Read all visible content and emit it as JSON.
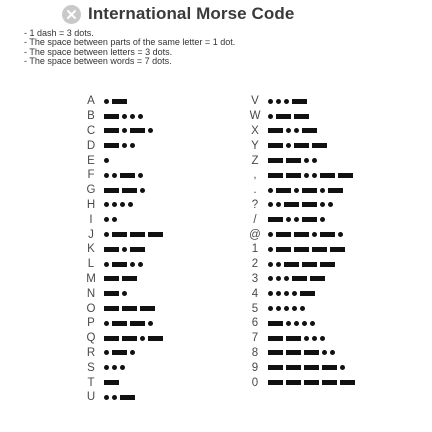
{
  "header": {
    "title": "International Morse Code",
    "close_icon": "close-icon"
  },
  "notes": [
    "- 1 dash = 3 dots.",
    "- The space between parts of the same letter = 1 dot.",
    "- The space between letters = 3 dots.",
    "- The space between words = 7 dots."
  ],
  "left_column": [
    {
      "char": "A",
      "code": ".-"
    },
    {
      "char": "B",
      "code": "-..."
    },
    {
      "char": "C",
      "code": "-.-."
    },
    {
      "char": "D",
      "code": "-.."
    },
    {
      "char": "E",
      "code": "."
    },
    {
      "char": "F",
      "code": "..-."
    },
    {
      "char": "G",
      "code": "--."
    },
    {
      "char": "H",
      "code": "...."
    },
    {
      "char": "I",
      "code": ".."
    },
    {
      "char": "J",
      "code": ".---"
    },
    {
      "char": "K",
      "code": "-.-"
    },
    {
      "char": "L",
      "code": ".-.."
    },
    {
      "char": "M",
      "code": "--"
    },
    {
      "char": "N",
      "code": "-."
    },
    {
      "char": "O",
      "code": "---"
    },
    {
      "char": "P",
      "code": ".--."
    },
    {
      "char": "Q",
      "code": "--.-"
    },
    {
      "char": "R",
      "code": ".-."
    },
    {
      "char": "S",
      "code": "..."
    },
    {
      "char": "T",
      "code": "-"
    },
    {
      "char": "U",
      "code": "..-"
    }
  ],
  "right_column": [
    {
      "char": "V",
      "code": "...-"
    },
    {
      "char": "W",
      "code": ".--"
    },
    {
      "char": "X",
      "code": "-..-"
    },
    {
      "char": "Y",
      "code": "-.--"
    },
    {
      "char": "Z",
      "code": "--.."
    },
    {
      "char": ",",
      "code": "--..--"
    },
    {
      "char": ".",
      "code": ".-.-.-"
    },
    {
      "char": "?",
      "code": "..--.."
    },
    {
      "char": "/",
      "code": "-..-."
    },
    {
      "char": "@",
      "code": ".--.-."
    },
    {
      "char": "1",
      "code": ".----"
    },
    {
      "char": "2",
      "code": "..---"
    },
    {
      "char": "3",
      "code": "...--"
    },
    {
      "char": "4",
      "code": "....-"
    },
    {
      "char": "5",
      "code": "....."
    },
    {
      "char": "6",
      "code": "-...."
    },
    {
      "char": "7",
      "code": "--..."
    },
    {
      "char": "8",
      "code": "---.."
    },
    {
      "char": "9",
      "code": "----."
    },
    {
      "char": "0",
      "code": "-----"
    }
  ]
}
